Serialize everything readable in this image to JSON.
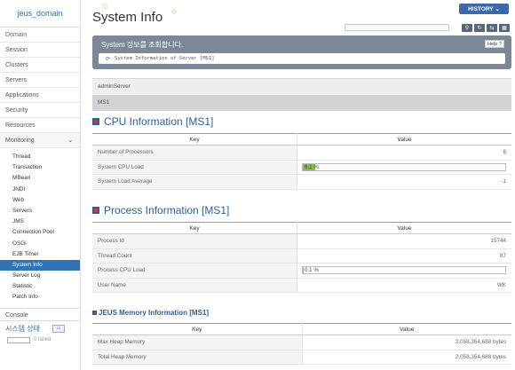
{
  "sidebar": {
    "domain_name": "jeus_domain",
    "items": [
      {
        "label": "Domain",
        "active": true
      },
      {
        "label": "Session"
      },
      {
        "label": "Clusters"
      },
      {
        "label": "Servers"
      },
      {
        "label": "Applications"
      },
      {
        "label": "Security"
      },
      {
        "label": "Resources"
      }
    ],
    "monitoring": {
      "label": "Monitoring",
      "chevron": "chevron-down-icon"
    },
    "monitoring_items": [
      "Thread",
      "Transaction",
      "MBean",
      "JNDI",
      "Web",
      "Servers",
      "JMS",
      "Connection Pool",
      "OSGi",
      "EJB Timer",
      "System Info",
      "Server Log",
      "Statistic",
      "Patch Info"
    ],
    "monitoring_active": "System Info",
    "console": {
      "label": "Console",
      "status_label": "시스템 상태",
      "failed_text": "0 failed"
    }
  },
  "header": {
    "title": "System Info",
    "history_label": "HISTORY",
    "tools": [
      "search-icon",
      "refresh-icon",
      "refresh-all-icon",
      "layout-icon"
    ]
  },
  "banner": {
    "title": "System 정보를 조회합니다.",
    "help_label": "Help",
    "subtitle": "System Information of Server [MS1]"
  },
  "servers": [
    "adminServer",
    "MS1"
  ],
  "cpu": {
    "title": "CPU Information [MS1]",
    "key_header": "Key",
    "value_header": "Value",
    "rows": [
      {
        "key": "Number of Processors",
        "value": "8"
      },
      {
        "key": "System CPU Load",
        "value": "6.1 %",
        "bar_percent": 6.1
      },
      {
        "key": "System Load Average",
        "value": "-1"
      }
    ]
  },
  "process": {
    "title": "Process Information [MS1]",
    "key_header": "Key",
    "value_header": "Value",
    "rows": [
      {
        "key": "Process Id",
        "value": "15744"
      },
      {
        "key": "Thread Count",
        "value": "87"
      },
      {
        "key": "Process CPU Load",
        "value": "0.1 %",
        "bar_percent": 0.1
      },
      {
        "key": "User Name",
        "value": "WK"
      }
    ]
  },
  "memory": {
    "title": "JEUS Memory Information [MS1]",
    "key_header": "Key",
    "value_header": "Value",
    "rows": [
      {
        "key": "Max Heap Memory",
        "value": "2,058,354,688 bytes"
      },
      {
        "key": "Total Heap Memory",
        "value": "2,058,354,688 bytes"
      }
    ]
  },
  "colors": {
    "accent": "#2f72b5",
    "banner": "#7d8896",
    "section": "#2f5f93",
    "bar_fill": "#8db85a"
  }
}
